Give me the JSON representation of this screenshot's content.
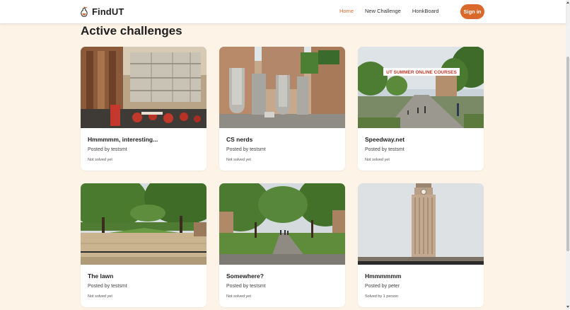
{
  "app": {
    "name": "FindUT",
    "logo_icon": "pear-icon"
  },
  "nav": {
    "links": [
      {
        "label": "Home",
        "active": true
      },
      {
        "label": "New Challenge",
        "active": false
      },
      {
        "label": "HonkBoard",
        "active": false
      }
    ],
    "signin_label": "Sign in"
  },
  "main": {
    "title": "Active challenges",
    "cards": [
      {
        "title": "Hmmmmm, interesting...",
        "author": "Posted by testsmt",
        "status": "Not solved yet",
        "image": "atrium interior with red chairs"
      },
      {
        "title": "CS nerds",
        "author": "Posted by testsmt",
        "status": "Not solved yet",
        "image": "UT letter sculpture in courtyard"
      },
      {
        "title": "Speedway.net",
        "author": "Posted by testsmt",
        "status": "Not solved yet",
        "image": "walkway with banner"
      },
      {
        "title": "The lawn",
        "author": "Posted by testsmt",
        "status": "Not solved yet",
        "image": "tree-lined lawn"
      },
      {
        "title": "Somewhere?",
        "author": "Posted by testsmt",
        "status": "Not solved yet",
        "image": "campus path with trees"
      },
      {
        "title": "Hmmmmmm",
        "author": "Posted by peter",
        "status": "Solved by 1 person",
        "image": "UT tower"
      }
    ],
    "banner_text": "UT SUMMER ONLINE COURSES"
  },
  "colors": {
    "accent": "#d9692b",
    "background": "#fdf3e7",
    "card": "#ffffff"
  }
}
